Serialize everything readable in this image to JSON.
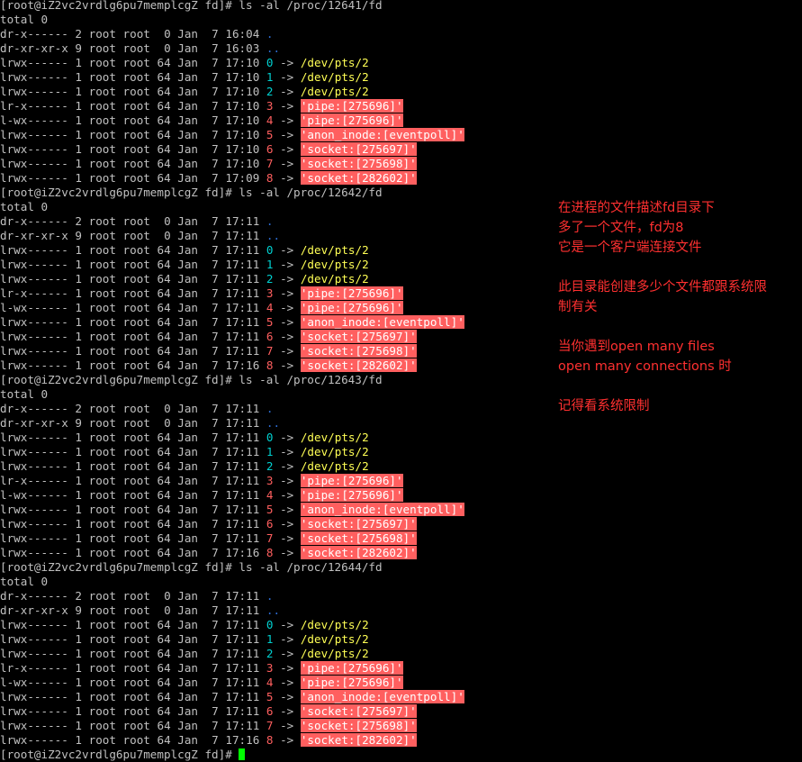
{
  "terminal": {
    "blocks": [
      {
        "prompt": "[root@iZ2vc2vrdlg6pu7memplcgZ fd]# ls -al /proc/12641/fd",
        "total": "total 0",
        "dirs": [
          {
            "perm": "dr-x------",
            "links": "2",
            "owner": "root",
            "group": "root",
            "size": " 0",
            "month": "Jan",
            "day": " 7",
            "time": "16:04",
            "name": "."
          },
          {
            "perm": "dr-xr-xr-x",
            "links": "9",
            "owner": "root",
            "group": "root",
            "size": " 0",
            "month": "Jan",
            "day": " 7",
            "time": "16:03",
            "name": ".."
          }
        ],
        "fds": [
          {
            "perm": "lrwx------",
            "time": "17:10",
            "fd": "0",
            "target": "/dev/pts/2",
            "hl": false
          },
          {
            "perm": "lrwx------",
            "time": "17:10",
            "fd": "1",
            "target": "/dev/pts/2",
            "hl": false
          },
          {
            "perm": "lrwx------",
            "time": "17:10",
            "fd": "2",
            "target": "/dev/pts/2",
            "hl": false
          },
          {
            "perm": "lr-x------",
            "time": "17:10",
            "fd": "3",
            "target": "'pipe:[275696]'",
            "hl": true
          },
          {
            "perm": "l-wx------",
            "time": "17:10",
            "fd": "4",
            "target": "'pipe:[275696]'",
            "hl": true
          },
          {
            "perm": "lrwx------",
            "time": "17:10",
            "fd": "5",
            "target": "'anon_inode:[eventpoll]'",
            "hl": true
          },
          {
            "perm": "lrwx------",
            "time": "17:10",
            "fd": "6",
            "target": "'socket:[275697]'",
            "hl": true
          },
          {
            "perm": "lrwx------",
            "time": "17:10",
            "fd": "7",
            "target": "'socket:[275698]'",
            "hl": true
          },
          {
            "perm": "lrwx------",
            "time": "17:09",
            "fd": "8",
            "target": "'socket:[282602]'",
            "hl": true
          }
        ]
      },
      {
        "prompt": "[root@iZ2vc2vrdlg6pu7memplcgZ fd]# ls -al /proc/12642/fd",
        "total": "total 0",
        "dirs": [
          {
            "perm": "dr-x------",
            "links": "2",
            "owner": "root",
            "group": "root",
            "size": " 0",
            "month": "Jan",
            "day": " 7",
            "time": "17:11",
            "name": "."
          },
          {
            "perm": "dr-xr-xr-x",
            "links": "9",
            "owner": "root",
            "group": "root",
            "size": " 0",
            "month": "Jan",
            "day": " 7",
            "time": "17:11",
            "name": ".."
          }
        ],
        "fds": [
          {
            "perm": "lrwx------",
            "time": "17:11",
            "fd": "0",
            "target": "/dev/pts/2",
            "hl": false
          },
          {
            "perm": "lrwx------",
            "time": "17:11",
            "fd": "1",
            "target": "/dev/pts/2",
            "hl": false
          },
          {
            "perm": "lrwx------",
            "time": "17:11",
            "fd": "2",
            "target": "/dev/pts/2",
            "hl": false
          },
          {
            "perm": "lr-x------",
            "time": "17:11",
            "fd": "3",
            "target": "'pipe:[275696]'",
            "hl": true
          },
          {
            "perm": "l-wx------",
            "time": "17:11",
            "fd": "4",
            "target": "'pipe:[275696]'",
            "hl": true
          },
          {
            "perm": "lrwx------",
            "time": "17:11",
            "fd": "5",
            "target": "'anon_inode:[eventpoll]'",
            "hl": true
          },
          {
            "perm": "lrwx------",
            "time": "17:11",
            "fd": "6",
            "target": "'socket:[275697]'",
            "hl": true
          },
          {
            "perm": "lrwx------",
            "time": "17:11",
            "fd": "7",
            "target": "'socket:[275698]'",
            "hl": true
          },
          {
            "perm": "lrwx------",
            "time": "17:16",
            "fd": "8",
            "target": "'socket:[282602]'",
            "hl": true
          }
        ]
      },
      {
        "prompt": "[root@iZ2vc2vrdlg6pu7memplcgZ fd]# ls -al /proc/12643/fd",
        "total": "total 0",
        "dirs": [
          {
            "perm": "dr-x------",
            "links": "2",
            "owner": "root",
            "group": "root",
            "size": " 0",
            "month": "Jan",
            "day": " 7",
            "time": "17:11",
            "name": "."
          },
          {
            "perm": "dr-xr-xr-x",
            "links": "9",
            "owner": "root",
            "group": "root",
            "size": " 0",
            "month": "Jan",
            "day": " 7",
            "time": "17:11",
            "name": ".."
          }
        ],
        "fds": [
          {
            "perm": "lrwx------",
            "time": "17:11",
            "fd": "0",
            "target": "/dev/pts/2",
            "hl": false
          },
          {
            "perm": "lrwx------",
            "time": "17:11",
            "fd": "1",
            "target": "/dev/pts/2",
            "hl": false
          },
          {
            "perm": "lrwx------",
            "time": "17:11",
            "fd": "2",
            "target": "/dev/pts/2",
            "hl": false
          },
          {
            "perm": "lr-x------",
            "time": "17:11",
            "fd": "3",
            "target": "'pipe:[275696]'",
            "hl": true
          },
          {
            "perm": "l-wx------",
            "time": "17:11",
            "fd": "4",
            "target": "'pipe:[275696]'",
            "hl": true
          },
          {
            "perm": "lrwx------",
            "time": "17:11",
            "fd": "5",
            "target": "'anon_inode:[eventpoll]'",
            "hl": true
          },
          {
            "perm": "lrwx------",
            "time": "17:11",
            "fd": "6",
            "target": "'socket:[275697]'",
            "hl": true
          },
          {
            "perm": "lrwx------",
            "time": "17:11",
            "fd": "7",
            "target": "'socket:[275698]'",
            "hl": true
          },
          {
            "perm": "lrwx------",
            "time": "17:16",
            "fd": "8",
            "target": "'socket:[282602]'",
            "hl": true
          }
        ]
      },
      {
        "prompt": "[root@iZ2vc2vrdlg6pu7memplcgZ fd]# ls -al /proc/12644/fd",
        "total": "total 0",
        "dirs": [
          {
            "perm": "dr-x------",
            "links": "2",
            "owner": "root",
            "group": "root",
            "size": " 0",
            "month": "Jan",
            "day": " 7",
            "time": "17:11",
            "name": "."
          },
          {
            "perm": "dr-xr-xr-x",
            "links": "9",
            "owner": "root",
            "group": "root",
            "size": " 0",
            "month": "Jan",
            "day": " 7",
            "time": "17:11",
            "name": ".."
          }
        ],
        "fds": [
          {
            "perm": "lrwx------",
            "time": "17:11",
            "fd": "0",
            "target": "/dev/pts/2",
            "hl": false
          },
          {
            "perm": "lrwx------",
            "time": "17:11",
            "fd": "1",
            "target": "/dev/pts/2",
            "hl": false
          },
          {
            "perm": "lrwx------",
            "time": "17:11",
            "fd": "2",
            "target": "/dev/pts/2",
            "hl": false
          },
          {
            "perm": "lr-x------",
            "time": "17:11",
            "fd": "3",
            "target": "'pipe:[275696]'",
            "hl": true
          },
          {
            "perm": "l-wx------",
            "time": "17:11",
            "fd": "4",
            "target": "'pipe:[275696]'",
            "hl": true
          },
          {
            "perm": "lrwx------",
            "time": "17:11",
            "fd": "5",
            "target": "'anon_inode:[eventpoll]'",
            "hl": true
          },
          {
            "perm": "lrwx------",
            "time": "17:11",
            "fd": "6",
            "target": "'socket:[275697]'",
            "hl": true
          },
          {
            "perm": "lrwx------",
            "time": "17:11",
            "fd": "7",
            "target": "'socket:[275698]'",
            "hl": true
          },
          {
            "perm": "lrwx------",
            "time": "17:16",
            "fd": "8",
            "target": "'socket:[282602]'",
            "hl": true
          }
        ]
      }
    ],
    "link_meta": {
      "links": "1",
      "owner": "root",
      "group": "root",
      "size": "64",
      "month": "Jan",
      "day": " 7",
      "arrow": "->"
    },
    "final_prompt": "[root@iZ2vc2vrdlg6pu7memplcgZ fd]# "
  },
  "notes": {
    "lines": [
      "在进程的文件描述fd目录下",
      "多了一个文件，fd为8",
      "它是一个客户端连接文件",
      "",
      "此目录能创建多少个文件都跟系统限",
      "制有关",
      "",
      "当你遇到open many files",
      "open many connections 时",
      "",
      "记得看系统限制"
    ]
  },
  "colors": {
    "background": "#000000",
    "text": "#c0c0c0",
    "highlight": "#ff5f5f",
    "fd_cyan": "#00d0d0",
    "dir_blue": "#2f6fd8",
    "link_yellow": "#ffff55",
    "note_red": "#ff3030",
    "cursor": "#00ff00"
  }
}
